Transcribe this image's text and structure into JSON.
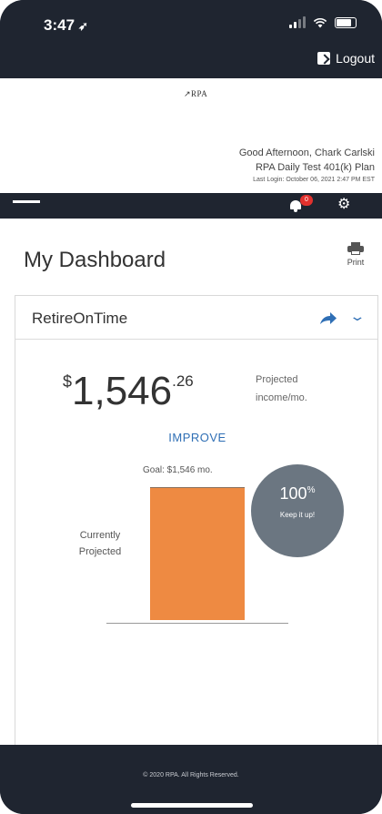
{
  "status_bar": {
    "time": "3:47"
  },
  "header": {
    "logout_label": "Logout",
    "logo_text": "RPA",
    "greeting": "Good Afternoon, Chark Carlski",
    "plan": "RPA Daily Test 401(k) Plan",
    "last_login": "Last Login: October 06, 2021 2:47 PM EST"
  },
  "nav": {
    "notification_count": "0"
  },
  "dashboard": {
    "title": "My Dashboard",
    "print_label": "Print"
  },
  "retire_card": {
    "title": "RetireOnTime",
    "currency_symbol": "$",
    "amount_whole": "1,546",
    "amount_cents": ".26",
    "projected_label_line1": "Projected",
    "projected_label_line2": "income/mo.",
    "improve_label": "IMPROVE",
    "goal_label": "Goal: $1,546 mo.",
    "bar_label_line1": "Currently",
    "bar_label_line2": "Projected",
    "percent_value": "100",
    "percent_sign": "%",
    "keep_label": "Keep it up!",
    "bar_color": "#ee8a42",
    "circle_color": "#6b7681",
    "accent_color": "#2f6fb5"
  },
  "chart_data": {
    "type": "bar",
    "categories": [
      "Currently Projected"
    ],
    "values": [
      1546
    ],
    "goal": 1546,
    "percent_of_goal": 100
  },
  "footer": {
    "copyright": "© 2020 RPA. All Rights Reserved."
  }
}
